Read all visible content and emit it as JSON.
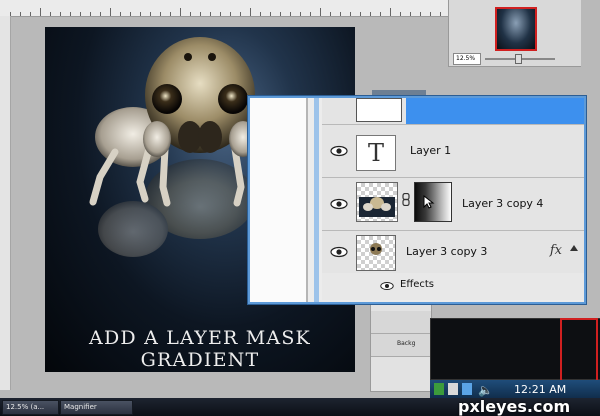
{
  "canvas": {
    "caption": "ADD A LAYER MASK GRADIENT"
  },
  "navigator": {
    "zoom": "12.5%"
  },
  "layers_panel_small": {
    "row_2_label": "Backg"
  },
  "layers_panel_magnified": {
    "layers": [
      {
        "name": "Layer 1",
        "thumb_glyph": "T"
      },
      {
        "name": "Layer 3 copy 4"
      },
      {
        "name": "Layer 3 copy 3",
        "fx": "fx"
      }
    ],
    "effects_label": "Effects"
  },
  "tray": {
    "clock": "12:21 AM"
  },
  "taskbar": {
    "items": [
      {
        "label": "12.5% (a..."
      },
      {
        "label": "Magnifier"
      }
    ]
  },
  "watermark": "pxleyes.com",
  "colors": {
    "selection_blue": "#3d90ee",
    "panel_border_blue": "#5d9ad8",
    "thumbnail_red": "#d02020"
  }
}
